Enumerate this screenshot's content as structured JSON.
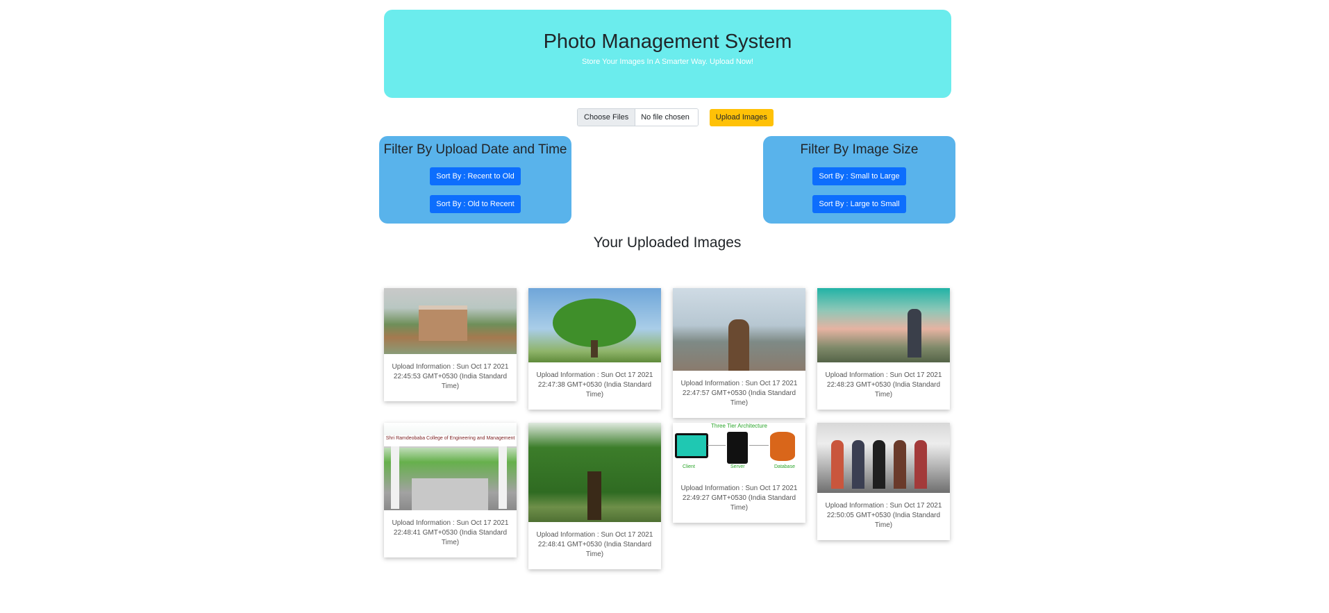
{
  "header": {
    "title": "Photo Management System",
    "subtitle": "Store Your Images In A Smarter Way. Upload Now!"
  },
  "upload": {
    "choose_files_label": "Choose Files",
    "file_status": "No file chosen",
    "upload_button_label": "Upload Images"
  },
  "filters": {
    "date": {
      "title": "Filter By Upload Date and Time",
      "recent_to_old": "Sort By : Recent to Old",
      "old_to_recent": "Sort By : Old to Recent"
    },
    "size": {
      "title": "Filter By Image Size",
      "small_to_large": "Sort By : Small to Large",
      "large_to_small": "Sort By : Large to Small"
    }
  },
  "gallery": {
    "title": "Your Uploaded Images",
    "items": [
      {
        "image": "college-campus-aerial",
        "info": "Upload Information : Sun Oct 17 2021 22:45:53 GMT+0530 (India Standard Time)"
      },
      {
        "image": "green-tree-field",
        "info": "Upload Information : Sun Oct 17 2021 22:47:38 GMT+0530 (India Standard Time)"
      },
      {
        "image": "hiker-arms-raised",
        "info": "Upload Information : Sun Oct 17 2021 22:47:57 GMT+0530 (India Standard Time)"
      },
      {
        "image": "hot-air-balloons",
        "info": "Upload Information : Sun Oct 17 2021 22:48:23 GMT+0530 (India Standard Time)"
      },
      {
        "image": "college-gate",
        "banner_text": "Shri Ramdeobaba College of Engineering and Management",
        "info": "Upload Information : Sun Oct 17 2021 22:48:41 GMT+0530 (India Standard Time)"
      },
      {
        "image": "large-tree-canopy",
        "info": "Upload Information : Sun Oct 17 2021 22:48:41 GMT+0530 (India Standard Time)"
      },
      {
        "image": "three-tier-architecture",
        "diagram_title": "Three Tier Architecture",
        "labels": [
          "Client",
          "Server",
          "Database"
        ],
        "info": "Upload Information : Sun Oct 17 2021 22:49:27 GMT+0530 (India Standard Time)"
      },
      {
        "image": "students-group",
        "info": "Upload Information : Sun Oct 17 2021 22:50:05 GMT+0530 (India Standard Time)"
      }
    ]
  }
}
